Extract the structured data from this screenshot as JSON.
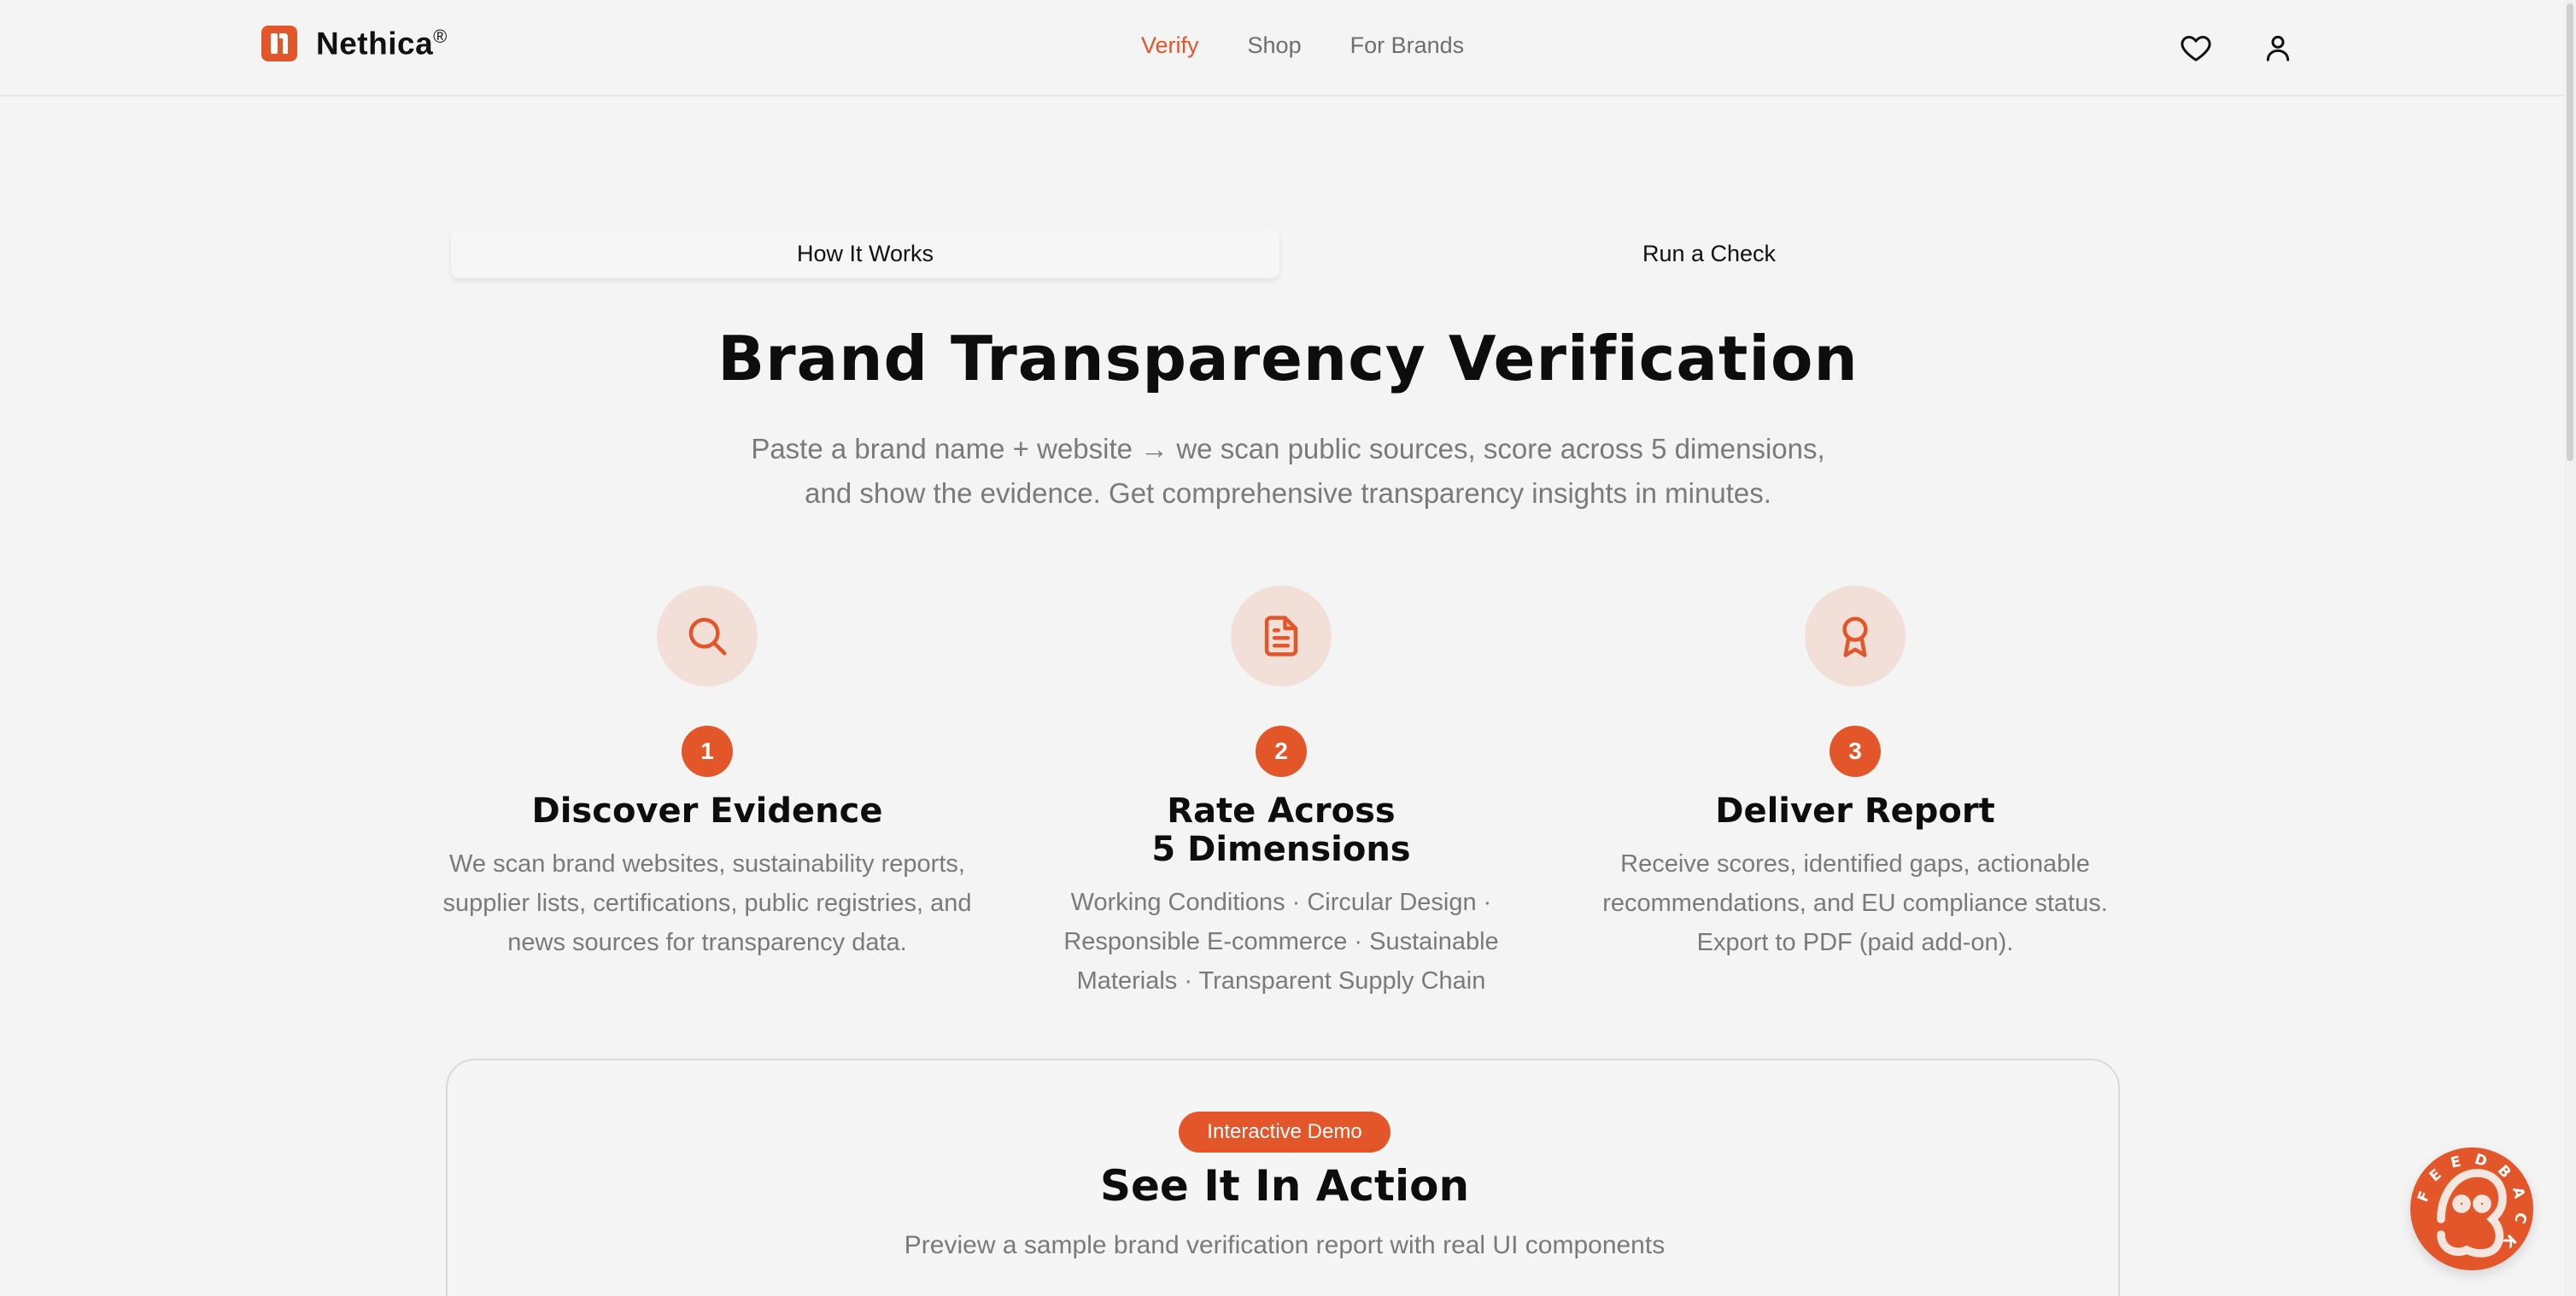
{
  "nav": {
    "brand": "Nethica",
    "brand_mark": "®",
    "links": [
      {
        "label": "Verify",
        "active": true
      },
      {
        "label": "Shop",
        "active": false
      },
      {
        "label": "For Brands",
        "active": false
      }
    ],
    "icons": [
      "heart-icon",
      "user-icon"
    ]
  },
  "tabs": [
    {
      "label": "How It Works",
      "active": true
    },
    {
      "label": "Run a Check",
      "active": false
    }
  ],
  "hero": {
    "title": "Brand Transparency Verification",
    "subtitle_line1": "Paste a brand name + website → we scan public sources, score across 5 dimensions,",
    "subtitle_line2": "and show the evidence. Get comprehensive transparency insights in minutes."
  },
  "steps": [
    {
      "number": "1",
      "icon": "search-icon",
      "title_line1": "Discover Evidence",
      "title_line2": "",
      "description": "We scan brand websites, sustainability reports, supplier lists, certifications, public registries, and news sources for transparency data."
    },
    {
      "number": "2",
      "icon": "document-icon",
      "title_line1": "Rate Across",
      "title_line2": "5 Dimensions",
      "description": "Working Conditions · Circular Design · Responsible E-commerce · Sustainable Materials · Transparent Supply Chain"
    },
    {
      "number": "3",
      "icon": "award-icon",
      "title_line1": "Deliver Report",
      "title_line2": "",
      "description": "Receive scores, identified gaps, actionable recommendations, and EU compliance status. Export to PDF (paid add-on)."
    }
  ],
  "demo": {
    "badge": "Interactive Demo",
    "title": "See It In Action",
    "subtitle": "Preview a sample brand verification report with real UI components"
  },
  "feedback": {
    "label": "FEEDBACK"
  },
  "colors": {
    "accent": "#e2562a",
    "icon_bg": "#f1dfd8",
    "page_bg": "#f4f4f4",
    "muted_text": "#7a7a7a"
  }
}
